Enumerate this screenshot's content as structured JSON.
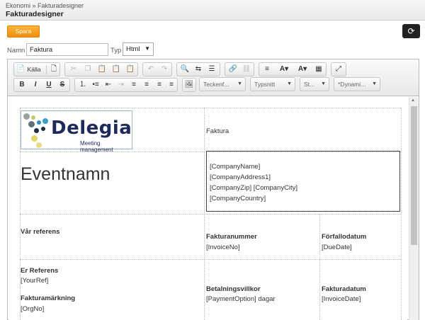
{
  "header": {
    "breadcrumb": "Ekonomi » Fakturadesigner",
    "title": "Fakturadesigner"
  },
  "actions": {
    "save_label": "Spara",
    "refresh_icon": "refresh-icon"
  },
  "form": {
    "name_label": "Namn",
    "name_value": "Faktura",
    "type_label": "Typ",
    "type_value": "Html"
  },
  "toolbar": {
    "source_label": "Källa",
    "font_format_placeholder": "Teckenf...",
    "font_placeholder": "Typsnitt",
    "size_placeholder": "St...",
    "dynamic_placeholder": "*Dynami..."
  },
  "document": {
    "logo_text": "Delegia",
    "logo_tagline": "Meeting management",
    "faktura_label": "Faktura",
    "event_name": "Eventnamn",
    "address_lines": [
      "[CompanyName]",
      "[CompanyAddress1]",
      "[CompanyZip] [CompanyCity]",
      "[CompanyCountry]"
    ],
    "our_reference_label": "Vår referens",
    "invoice_number_label": "Fakturanummer",
    "invoice_number_value": "[InvoiceNo]",
    "due_date_label": "Förfallodatum",
    "due_date_value": "[DueDate]",
    "your_reference_label": "Er Referens",
    "your_reference_value": "[YourRef]",
    "invoice_marking_label": "Fakturamärkning",
    "invoice_marking_value": "[OrgNo]",
    "payment_terms_label": "Betalningsvillkor",
    "payment_terms_value": "[PaymentOption] dagar",
    "invoice_date_label": "Fakturadatum",
    "invoice_date_value": "[InvoiceDate]"
  },
  "colors": {
    "save_button": "#f39c12",
    "logo_text": "#1e2a5a"
  }
}
